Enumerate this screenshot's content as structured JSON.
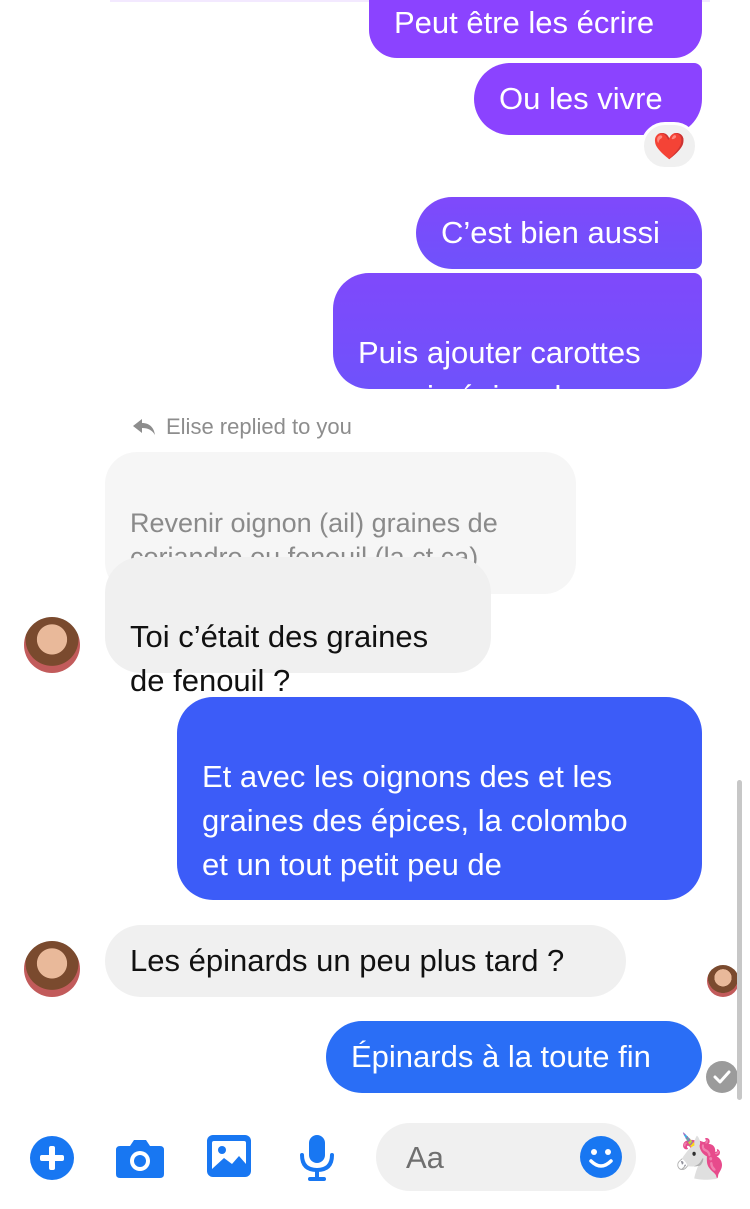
{
  "conversation": {
    "messages": [
      {
        "text": "Peut être les écrire"
      },
      {
        "text": "Ou les vivre"
      },
      {
        "text": "C’est bien aussi"
      },
      {
        "text": "Puis ajouter carottes\npanais épinards"
      },
      {
        "text": "Toi c’était des graines\nde fenouil ?"
      },
      {
        "text": "Et avec les oignons des et les\ngraines des épices, la colombo\net un tout petit peu de\ncurcuma"
      },
      {
        "text": "Les épinards un peu plus tard ?"
      },
      {
        "text": "Épinards à la toute fin"
      }
    ],
    "reaction": {
      "emoji": "❤️"
    },
    "reply_label": "Elise replied to you",
    "quoted_text": "Revenir oignon (ail) graines de\ncoriandre ou fenouil (la ct ça)"
  },
  "composer": {
    "placeholder": "Aa",
    "accent_color": "#1877f2",
    "icons": [
      "add-icon",
      "camera-icon",
      "image-icon",
      "microphone-icon",
      "emoji-icon",
      "unicorn-icon"
    ],
    "unicorn": "🦄"
  }
}
